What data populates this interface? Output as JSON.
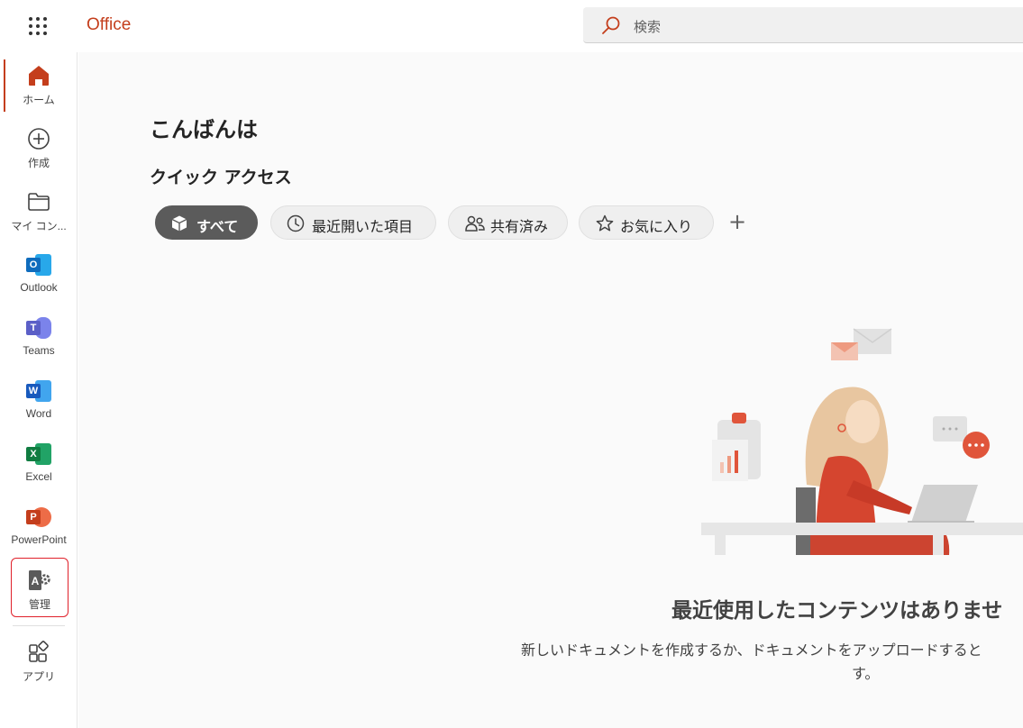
{
  "header": {
    "brand": "Office",
    "search_placeholder": "検索"
  },
  "rail": {
    "items": [
      {
        "label": "ホーム"
      },
      {
        "label": "作成"
      },
      {
        "label": "マイ コン..."
      },
      {
        "label": "Outlook"
      },
      {
        "label": "Teams"
      },
      {
        "label": "Word"
      },
      {
        "label": "Excel"
      },
      {
        "label": "PowerPoint"
      },
      {
        "label": "管理"
      },
      {
        "label": "アプリ"
      }
    ]
  },
  "main": {
    "greeting": "こんばんは",
    "quick_access": "クイック アクセス",
    "filters": [
      "すべて",
      "最近開いた項目",
      "共有済み",
      "お気に入り"
    ],
    "add_label": "+",
    "empty_title": "最近使用したコンテンツはありませ",
    "empty_desc_line1": "新しいドキュメントを作成するか、ドキュメントをアップロードすると",
    "empty_desc_line2": "す。"
  },
  "colors": {
    "brand": "#c43e1c",
    "outlook": "#0f6cbd",
    "teams": "#5b5fc7",
    "word": "#185abd",
    "excel": "#107c41",
    "powerpoint": "#c43e1c",
    "highlight": "#e0202a"
  },
  "icons": {
    "waffle": "app-launcher-icon",
    "search": "search-icon",
    "home": "home-icon",
    "create": "plus-circle-icon",
    "folder": "folder-icon",
    "admin": "admin-icon",
    "apps": "apps-icon"
  }
}
